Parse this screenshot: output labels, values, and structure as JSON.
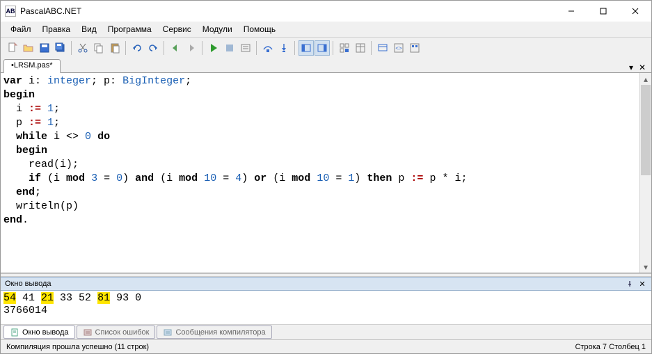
{
  "window": {
    "title": "PascalABC.NET"
  },
  "menu": {
    "items": [
      "Файл",
      "Правка",
      "Вид",
      "Программа",
      "Сервис",
      "Модули",
      "Помощь"
    ]
  },
  "tabs": {
    "active": "•LRSM.pas*"
  },
  "code": {
    "l1": {
      "kw1": "var",
      "id1": " i: ",
      "typ1": "integer",
      "txt1": "; p: ",
      "typ2": "BigInteger",
      "txt2": ";"
    },
    "l2": {
      "kw": "begin"
    },
    "l3": {
      "sp": "  i ",
      "op": ":=",
      "num": " 1",
      "txt": ";"
    },
    "l4": {
      "sp": "  p ",
      "op": ":=",
      "num": " 1",
      "txt": ";"
    },
    "l5": {
      "sp": "  ",
      "kw1": "while",
      "txt1": " i <> ",
      "num": "0",
      "txt2": " ",
      "kw2": "do"
    },
    "l6": {
      "sp": "  ",
      "kw": "begin"
    },
    "l7": {
      "sp": "    ",
      "fn": "read(i);"
    },
    "l8": {
      "sp": "    ",
      "kw1": "if",
      "txt1": " (i ",
      "kw2": "mod",
      "txt2": " ",
      "n1": "3",
      "txt3": " = ",
      "n2": "0",
      "txt4": ") ",
      "kw3": "and",
      "txt5": " (i ",
      "kw4": "mod",
      "txt6": " ",
      "n3": "10",
      "txt7": " = ",
      "n4": "4",
      "txt8": ") ",
      "kw5": "or",
      "txt9": " (i ",
      "kw6": "mod",
      "txt10": " ",
      "n5": "10",
      "txt11": " = ",
      "n6": "1",
      "txt12": ") ",
      "kw7": "then",
      "txt13": " p ",
      "op": ":=",
      "txt14": " p * i;"
    },
    "l9": {
      "sp": "  ",
      "kw": "end",
      "txt": ";"
    },
    "l10": {
      "sp": "  ",
      "fn": "writeln(p)"
    },
    "l11": {
      "kw": "end",
      "txt": "."
    }
  },
  "output": {
    "title": "Окно вывода",
    "line1": {
      "p1": "54",
      "p2": " 41 ",
      "p3": "21",
      "p4": " 33 52 ",
      "p5": "81",
      "p6": " 93 0"
    },
    "line2": "3766014"
  },
  "bottomTabs": {
    "t1": "Окно вывода",
    "t2": "Список ошибок",
    "t3": "Сообщения компилятора"
  },
  "status": {
    "left": "Компиляция прошла успешно (11 строк)",
    "right": "Строка  7  Столбец  1"
  }
}
